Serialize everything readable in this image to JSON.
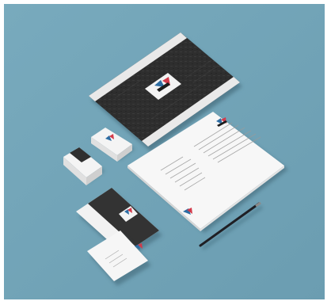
{
  "scene": {
    "subject": "stationery-mockup",
    "background_color": "#72a4b8"
  },
  "items": [
    {
      "name": "dark-poster-sheet",
      "color": "#2c2c2c"
    },
    {
      "name": "letterhead-sheet",
      "color": "#f7f7f7"
    },
    {
      "name": "business-card-stack-back",
      "color": "#f4f4f4"
    },
    {
      "name": "business-card-stack-front",
      "color": "#f4f4f4"
    },
    {
      "name": "envelope-dark",
      "color": "#333333"
    },
    {
      "name": "compliment-card",
      "color": "#f6f6f6"
    },
    {
      "name": "pencil",
      "color": "#1f1f24"
    }
  ],
  "brand": {
    "colors": {
      "blue": "#2d6da3",
      "red": "#d23a4a",
      "dark": "#1c1c1c"
    }
  }
}
